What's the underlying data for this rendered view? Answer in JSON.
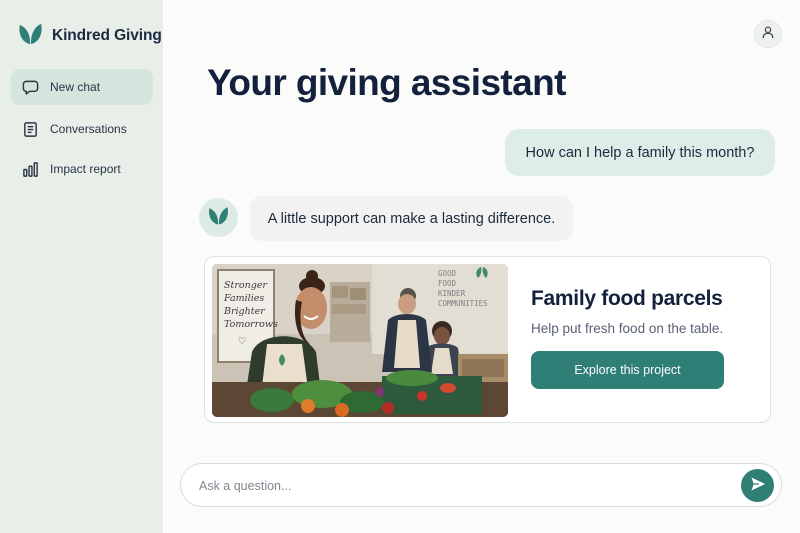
{
  "brand": {
    "name": "Kindred Giving",
    "logo_icon": "leaf-icon",
    "accent_color": "#2f7f77"
  },
  "sidebar": {
    "items": [
      {
        "label": "New chat",
        "icon": "chat-bubble-icon",
        "active": true
      },
      {
        "label": "Conversations",
        "icon": "document-icon",
        "active": false
      },
      {
        "label": "Impact report",
        "icon": "bar-chart-icon",
        "active": false
      }
    ]
  },
  "header": {
    "title": "Your giving assistant",
    "profile_icon": "user-icon"
  },
  "chat": {
    "user_message": "How can I help a family this month?",
    "assistant_message": "A little support can make a lasting difference.",
    "assistant_avatar_icon": "leaf-icon"
  },
  "project_card": {
    "title": "Family food parcels",
    "subtitle": "Help put fresh food on the table.",
    "button_label": "Explore this project",
    "photo": {
      "sign_text": [
        "Stronger",
        "Families",
        "Brighter",
        "Tomorrows",
        "♡"
      ],
      "wall_text": [
        "GOOD",
        "FOOD",
        "KINDER",
        "COMMUNITIES"
      ]
    }
  },
  "composer": {
    "placeholder": "Ask a question...",
    "send_icon": "send-icon"
  }
}
